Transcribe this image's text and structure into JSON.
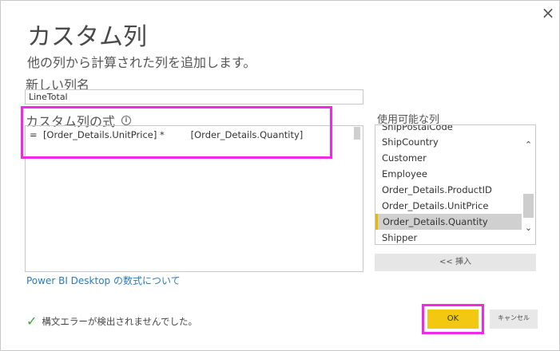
{
  "dialog": {
    "close_icon": "×",
    "title": "カスタム列",
    "subtitle": "他の列から計算された列を追加します。"
  },
  "new_column": {
    "label": "新しい列名",
    "value": "LineTotal"
  },
  "formula": {
    "label": "カスタム列の式",
    "info_icon": "i",
    "text": "=  [Order_Details.UnitPrice] *         [Order_Details.Quantity]"
  },
  "available_columns": {
    "label": "使用可能な列",
    "items": [
      "ShipPostalCode",
      "ShipCountry",
      "Customer",
      "Employee",
      "Order_Details.ProductID",
      "Order_Details.UnitPrice",
      "Order_Details.Quantity",
      "Shipper"
    ],
    "selected": "Order_Details.Quantity",
    "insert_label": "<< 挿入"
  },
  "help_link": "Power  BI  Desktop の数式について",
  "status": {
    "icon": "✓",
    "text": "構文エラーが検出されませんでした。"
  },
  "buttons": {
    "ok": "OK",
    "cancel": "キャンセル"
  },
  "colors": {
    "highlight": "#ee2ae6",
    "ok_button": "#f2c811",
    "link": "#2a7bbf",
    "check": "#3aa335"
  }
}
